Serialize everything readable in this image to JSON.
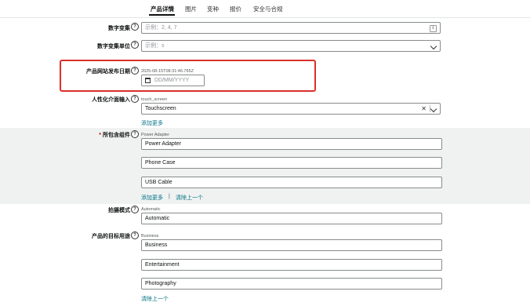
{
  "tabs": [
    {
      "label": "产品详情",
      "active": true
    },
    {
      "label": "图片",
      "active": false
    },
    {
      "label": "变种",
      "active": false
    },
    {
      "label": "报价",
      "active": false
    },
    {
      "label": "安全与合规",
      "active": false
    }
  ],
  "fields": {
    "number_set": {
      "label": "数字变集",
      "placeholder": "示例：2, 4, 7"
    },
    "number_unit": {
      "label": "数字变集单位",
      "placeholder": "示例：s"
    },
    "release_date": {
      "label": "产品网站发布日期",
      "hint": "2025-08-15T08:31:46.765Z",
      "placeholder": "DD/MM/YYYY"
    },
    "hci_input": {
      "label": "人性化介面输入",
      "hint": "touch_screen",
      "value": "Touchscreen",
      "add_more": "添加更多"
    },
    "included_components": {
      "required_mark": "*",
      "label": "所包含组件",
      "hint": "Power Adapter",
      "values": [
        "Power Adapter",
        "Phone Case",
        "USB Cable"
      ],
      "add_more": "添加更多",
      "separator": "|",
      "remove_last": "清除上一个"
    },
    "mode": {
      "label": "拍摄模式",
      "hint": "Automatic",
      "value": "Automatic"
    },
    "intended_use": {
      "label": "产品的目标用途",
      "hint": "Business",
      "values": [
        "Business",
        "Entertainment",
        "Photography"
      ],
      "remove_last": "清除上一个"
    }
  },
  "icons": {
    "help": "help-circle-icon",
    "calendar": "calendar-icon",
    "dropdown": "chevron-down-icon",
    "clear": "close-icon",
    "stepper": "stepper-icon"
  },
  "colors": {
    "highlight": "#d9302b",
    "link": "#007185",
    "section_bg": "#f0f2f2"
  }
}
